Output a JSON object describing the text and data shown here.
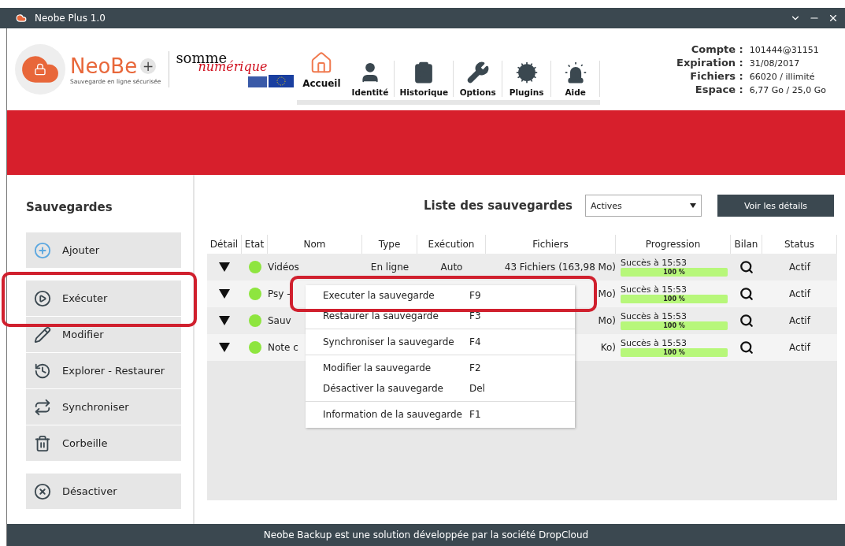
{
  "window": {
    "title": "Neobe Plus 1.0"
  },
  "brand": {
    "name": "NeoBe",
    "plus": "+",
    "tagline": "Sauvegarde en ligne sécurisée",
    "partner_top": "somme",
    "partner_script": "numérique"
  },
  "nav": [
    {
      "label": "Accueil",
      "selected": true
    },
    {
      "label": "Identité",
      "selected": false
    },
    {
      "label": "Historique",
      "selected": false
    },
    {
      "label": "Options",
      "selected": false
    },
    {
      "label": "Plugins",
      "selected": false
    },
    {
      "label": "Aide",
      "selected": false
    }
  ],
  "account": [
    {
      "label": "Compte :",
      "value": "101444@31151"
    },
    {
      "label": "Expiration :",
      "value": "31/08/2017"
    },
    {
      "label": "Fichiers :",
      "value": "66020 / illimité"
    },
    {
      "label": "Espace :",
      "value": "6,77 Go / 25,0 Go"
    }
  ],
  "sidebar": {
    "title": "Sauvegardes",
    "groups": [
      [
        "Ajouter"
      ],
      [
        "Exécuter",
        "Modifier",
        "Explorer - Restaurer",
        "Synchroniser",
        "Corbeille"
      ],
      [
        "Désactiver"
      ]
    ]
  },
  "list": {
    "title": "Liste des sauvegardes",
    "filter": "Actives",
    "details_button": "Voir les détails"
  },
  "table": {
    "columns": [
      "Détail",
      "Etat",
      "Nom",
      "Type",
      "Exécution",
      "Fichiers",
      "Progression",
      "Bilan",
      "Status"
    ],
    "rows": [
      {
        "ok": true,
        "name": "Vidéos",
        "type": "En ligne",
        "execution": "Auto",
        "files": "43 Fichiers (163,98 Mo)",
        "progress_text": "Succès à 15:53",
        "level": 1,
        "percent": "100 %",
        "status": "Actif"
      },
      {
        "ok": true,
        "name": "Psy -",
        "files": "Mo)",
        "progress_text": "Succès à 15:53",
        "level": 1,
        "percent": "100 %",
        "status": "Actif"
      },
      {
        "ok": true,
        "name": "Sauv",
        "files": "Mo)",
        "progress_text": "Succès à 15:53",
        "level": 1,
        "percent": "100 %",
        "status": "Actif"
      },
      {
        "ok": true,
        "name": "Note c",
        "files": "Ko)",
        "progress_text": "Succès à 15:53",
        "level": 1,
        "percent": "100 %",
        "status": "Actif"
      }
    ]
  },
  "context_menu": [
    {
      "label": "Executer la sauvegarde",
      "shortcut": "F9",
      "divider_before": false
    },
    {
      "label": "Restaurer la sauvegarde",
      "shortcut": "F3",
      "divider_before": false
    },
    {
      "label": "Synchroniser la sauvegarde",
      "shortcut": "F4",
      "divider_before": true
    },
    {
      "label": "Modifier la sauvegarde",
      "shortcut": "F2",
      "divider_before": true
    },
    {
      "label": "Désactiver la sauvegarde",
      "shortcut": "Del",
      "divider_before": false
    },
    {
      "label": "Information de la sauvegarde",
      "shortcut": "F1",
      "divider_before": true
    }
  ],
  "footer": "Neobe Backup est une solution développée par la société DropCloud"
}
